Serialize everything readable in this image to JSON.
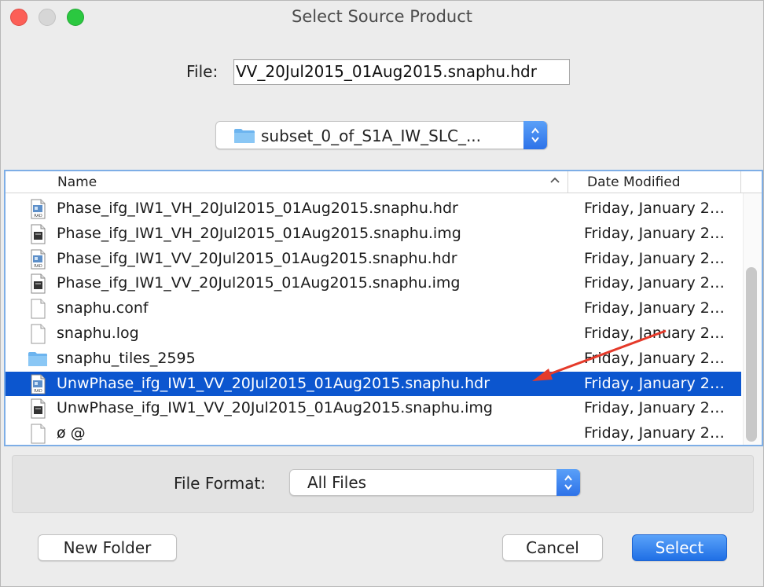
{
  "window": {
    "title": "Select Source Product"
  },
  "file_field": {
    "label": "File:",
    "value": "VV_20Jul2015_01Aug2015.snaphu.hdr"
  },
  "folder": {
    "name": "subset_0_of_S1A_IW_SLC_...",
    "icon": "folder-icon"
  },
  "list": {
    "headers": {
      "name": "Name",
      "date": "Date Modified"
    },
    "rows": [
      {
        "name": "Phase_ifg_IW1_VH_20Jul2015_01Aug2015.snaphu.hdr",
        "date": "Friday, January 2…",
        "icon": "rad-file-icon",
        "selected": false
      },
      {
        "name": "Phase_ifg_IW1_VH_20Jul2015_01Aug2015.snaphu.img",
        "date": "Friday, January 2…",
        "icon": "image-file-icon",
        "selected": false
      },
      {
        "name": "Phase_ifg_IW1_VV_20Jul2015_01Aug2015.snaphu.hdr",
        "date": "Friday, January 2…",
        "icon": "rad-file-icon",
        "selected": false
      },
      {
        "name": "Phase_ifg_IW1_VV_20Jul2015_01Aug2015.snaphu.img",
        "date": "Friday, January 2…",
        "icon": "image-file-icon",
        "selected": false
      },
      {
        "name": "snaphu.conf",
        "date": "Friday, January 2…",
        "icon": "document-icon",
        "selected": false
      },
      {
        "name": "snaphu.log",
        "date": "Friday, January 2…",
        "icon": "document-icon",
        "selected": false
      },
      {
        "name": "snaphu_tiles_2595",
        "date": "Friday, January 2…",
        "icon": "folder-icon",
        "selected": false
      },
      {
        "name": "UnwPhase_ifg_IW1_VV_20Jul2015_01Aug2015.snaphu.hdr",
        "date": "Friday, January 2…",
        "icon": "rad-file-icon",
        "selected": true
      },
      {
        "name": "UnwPhase_ifg_IW1_VV_20Jul2015_01Aug2015.snaphu.img",
        "date": "Friday, January 2…",
        "icon": "image-file-icon",
        "selected": false
      },
      {
        "name": "ø @",
        "date": "Friday, January 2…",
        "icon": "document-icon",
        "selected": false
      }
    ]
  },
  "format": {
    "label": "File Format:",
    "value": "All Files"
  },
  "buttons": {
    "new_folder": "New Folder",
    "cancel": "Cancel",
    "select": "Select"
  },
  "colors": {
    "selection": "#0c56cf",
    "accent": "#1f6fe5",
    "annotation_arrow": "#e53a2a"
  }
}
